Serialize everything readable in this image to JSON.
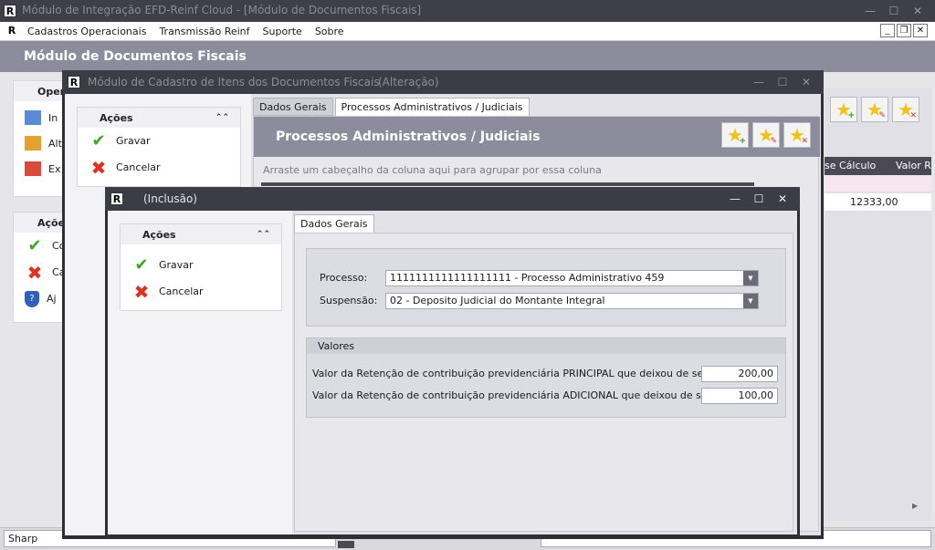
{
  "main_window": {
    "title": "Módulo de Integração EFD-Reinf Cloud - [Módulo de Documentos Fiscais]",
    "menu": [
      "Cadastros Operacionais",
      "Transmissão Reinf",
      "Suporte",
      "Sobre"
    ],
    "header_title": "Módulo de Documentos Fiscais",
    "left_panel1_title": "Oper",
    "left_panel1_items": [
      "In",
      "Alt",
      "Ex"
    ],
    "left_panel2_title": "Açõe",
    "left_panel2_items": [
      "Co",
      "Ca",
      "Aj"
    ],
    "grid_headers": [
      "se Cálculo",
      "Valor R"
    ],
    "grid_value": "12333,00",
    "status_text": "Sharp"
  },
  "mid_window": {
    "title": "Módulo de Cadastro de Itens dos Documentos Fiscais",
    "mode": "(Alteração)",
    "actions_title": "Ações",
    "actions": [
      "Gravar",
      "Cancelar"
    ],
    "tabs": [
      "Dados Gerais",
      "Processos Administrativos / Judiciais"
    ],
    "section_title": "Processos Administrativos / Judiciais",
    "group_hint": "Arraste um cabeçalho da coluna aqui para agrupar por essa coluna"
  },
  "front_window": {
    "title": "(Inclusão)",
    "actions_title": "Ações",
    "actions": [
      "Gravar",
      "Cancelar"
    ],
    "tab": "Dados Gerais",
    "processo_label": "Processo:",
    "processo_value": "1111111111111111111 - Processo Administrativo 459",
    "suspensao_label": "Suspensão:",
    "suspensao_value": "02 - Deposito Judicial do Montante Integral",
    "valores_title": "Valores",
    "principal_label": "Valor da Retenção de contribuição previdenciária PRINCIPAL que deixou de ser efetuada:",
    "principal_value": "200,00",
    "adicional_label": "Valor da Retenção de contribuição previdenciária ADICIONAL que deixou de ser efetuada:",
    "adicional_value": "100,00"
  }
}
